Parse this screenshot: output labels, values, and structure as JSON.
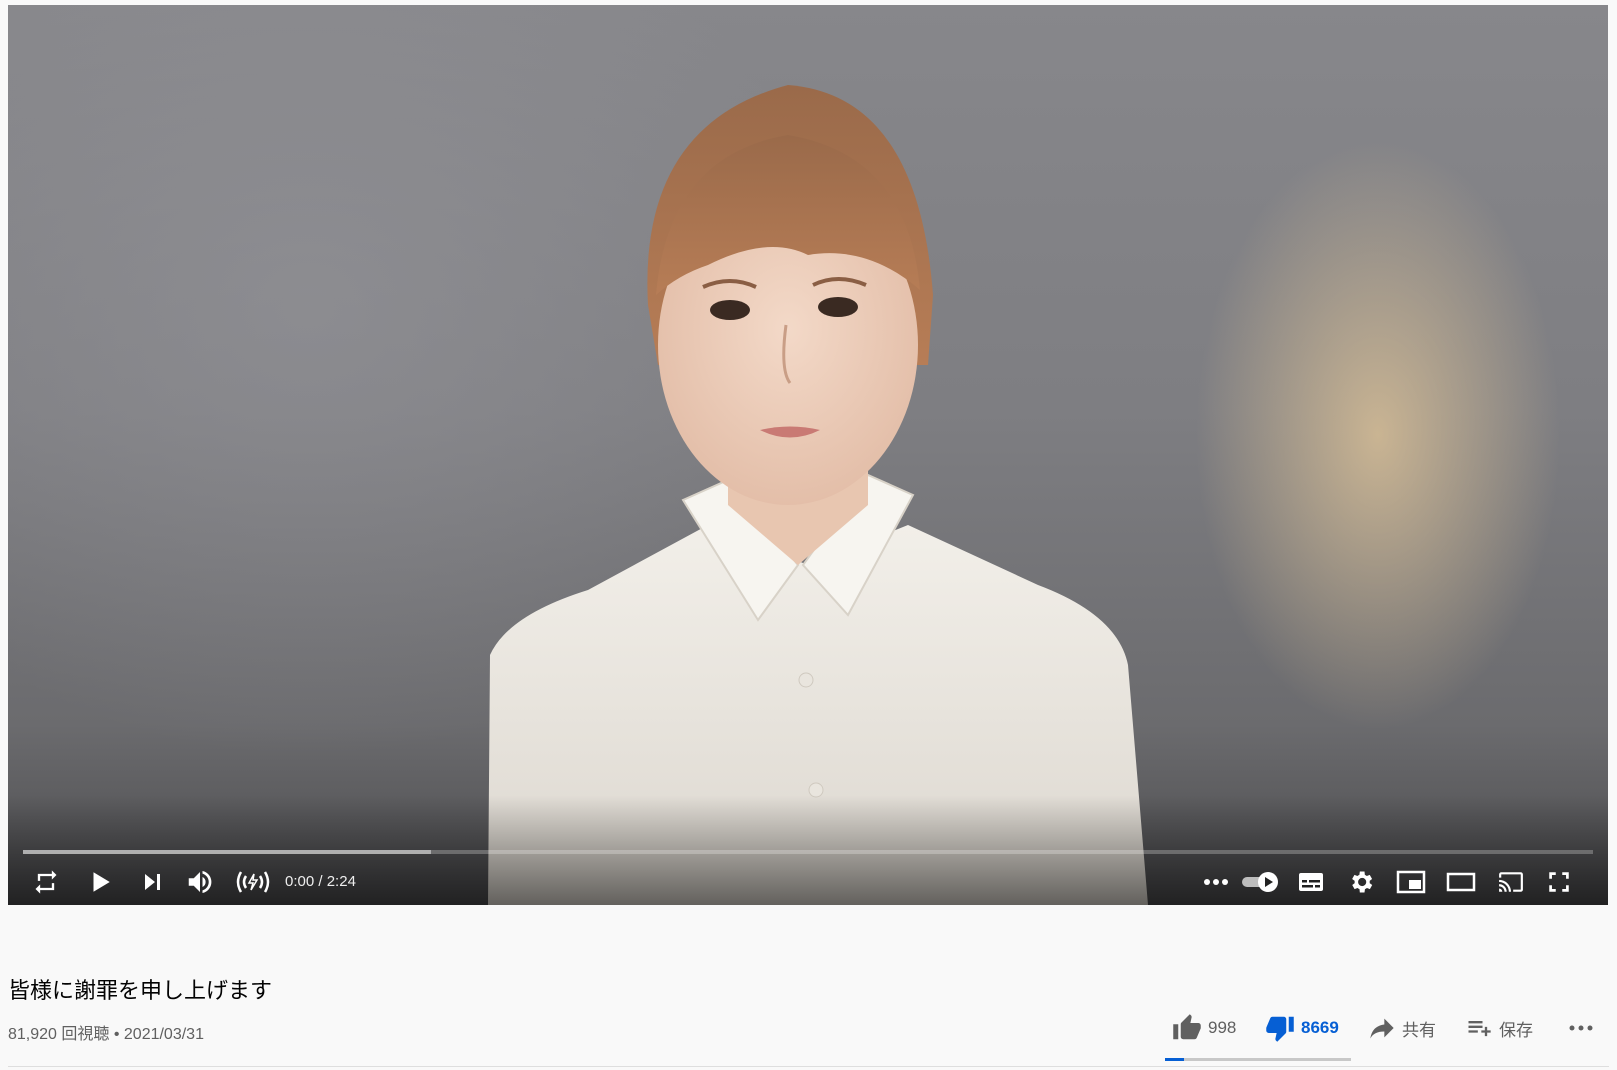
{
  "player": {
    "time_current": "0:00",
    "time_separator": " / ",
    "time_total": "2:24",
    "progress_played_fraction": 0.0,
    "progress_buffered_fraction": 0.26,
    "icons": {
      "loop": "loop-icon",
      "play": "play-icon",
      "next": "next-icon",
      "volume": "volume-icon",
      "live": "live-icon",
      "more": "more-icon",
      "autoplay": "autoplay-toggle-icon",
      "subtitles": "subtitles-icon",
      "settings": "settings-gear-icon",
      "miniplayer": "miniplayer-icon",
      "theater": "theater-mode-icon",
      "cast": "cast-icon",
      "fullscreen": "fullscreen-icon"
    }
  },
  "video": {
    "title": "皆様に謝罪を申し上げます",
    "views": "81,920 回視聴",
    "separator": " • ",
    "date": "2021/03/31"
  },
  "actions": {
    "like_count": "998",
    "dislike_count": "8669",
    "share_label": "共有",
    "save_label": "保存",
    "like_ratio": 0.103
  },
  "colors": {
    "accent_blue": "#065fd4",
    "progress_red": "#ff0000",
    "text_primary": "#030303",
    "text_secondary": "#606060"
  }
}
